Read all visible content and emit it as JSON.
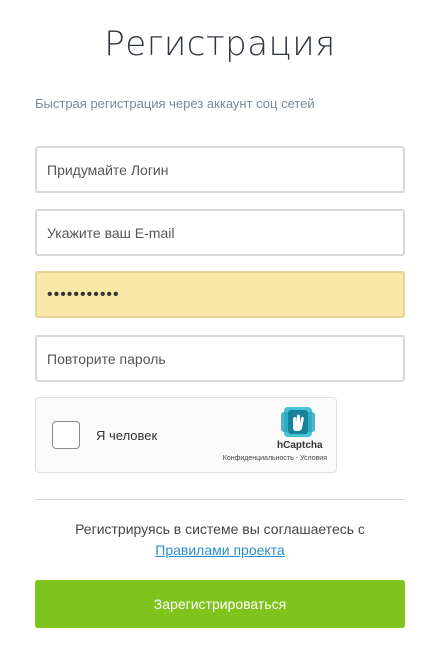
{
  "page": {
    "title": "Регистрация",
    "social_link": "Быстрая регистрация через аккаунт соц сетей"
  },
  "form": {
    "login": {
      "value": "",
      "placeholder": "Придумайте Логин"
    },
    "email": {
      "value": "",
      "placeholder": "Укажите ваш E-mail"
    },
    "password": {
      "value": "•••••••••••",
      "placeholder": ""
    },
    "password_repeat": {
      "value": "",
      "placeholder": "Повторите пароль"
    },
    "autofill_color": "#fbe8a6"
  },
  "captcha": {
    "label": "Я человек",
    "brand": "hCaptcha",
    "privacy_link": "Конфиденциальность",
    "separator": " - ",
    "terms_link": "Условия",
    "logo_icon": "hcaptcha-logo-icon",
    "checked": false
  },
  "agreement": {
    "text": "Регистрируясь в системе вы соглашаетесь с",
    "link": "Правилами проекта"
  },
  "submit": {
    "label": "Зарегистрироваться",
    "color": "#7fc31c"
  }
}
